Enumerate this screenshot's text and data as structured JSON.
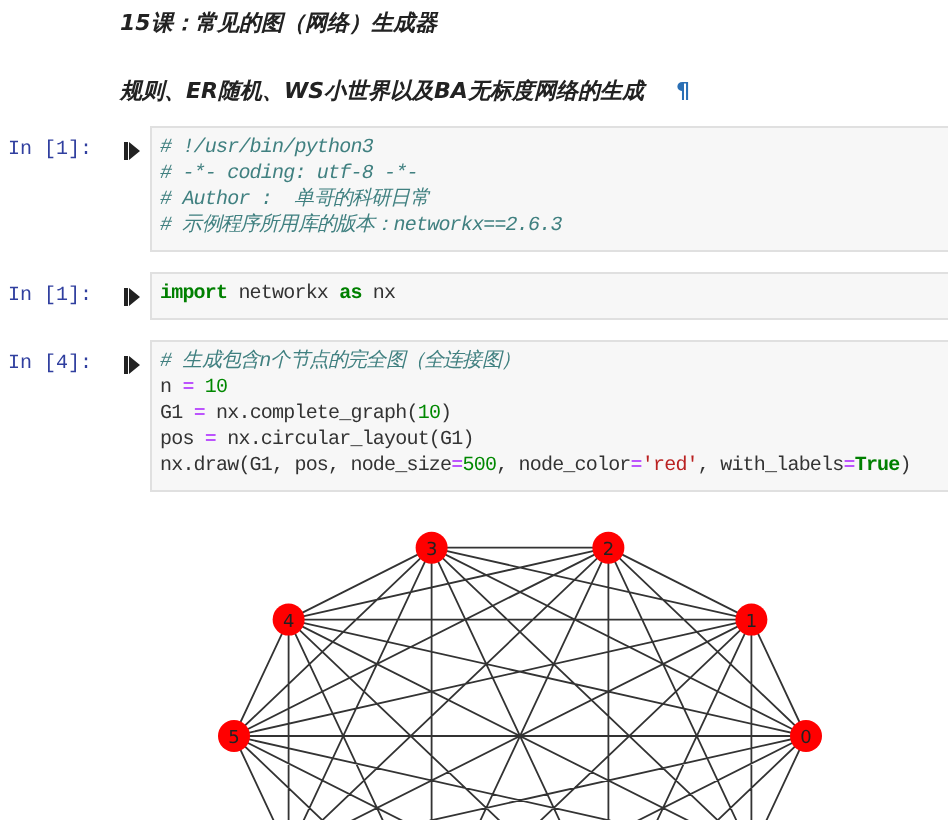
{
  "title": "15课：常见的图（网络）生成器",
  "subtitle": "规则、ER随机、WS小世界以及BA无标度网络的生成",
  "anchor": "¶",
  "cells": [
    {
      "prompt": "In [1]:",
      "lines": [
        [
          {
            "kind": "comment",
            "text": "# !/usr/bin/python3"
          }
        ],
        [
          {
            "kind": "comment",
            "text": "# -*- coding: utf-8 -*-"
          }
        ],
        [
          {
            "kind": "comment",
            "text": "# Author :  单哥的科研日常"
          }
        ],
        [
          {
            "kind": "comment",
            "text": "# 示例程序所用库的版本：networkx==2.6.3"
          }
        ]
      ]
    },
    {
      "prompt": "In [1]:",
      "lines": [
        [
          {
            "kind": "keyword",
            "text": "import"
          },
          {
            "kind": "plain",
            "text": " networkx "
          },
          {
            "kind": "keyword",
            "text": "as"
          },
          {
            "kind": "plain",
            "text": " nx"
          }
        ]
      ]
    },
    {
      "prompt": "In [4]:",
      "lines": [
        [
          {
            "kind": "comment",
            "text": "# 生成包含n个节点的完全图（全连接图）"
          }
        ],
        [
          {
            "kind": "plain",
            "text": "n "
          },
          {
            "kind": "operator",
            "text": "="
          },
          {
            "kind": "number",
            "text": " 10"
          }
        ],
        [
          {
            "kind": "plain",
            "text": "G1 "
          },
          {
            "kind": "operator",
            "text": "="
          },
          {
            "kind": "plain",
            "text": " nx.complete_graph("
          },
          {
            "kind": "number",
            "text": "10"
          },
          {
            "kind": "plain",
            "text": ")"
          }
        ],
        [
          {
            "kind": "plain",
            "text": "pos "
          },
          {
            "kind": "operator",
            "text": "="
          },
          {
            "kind": "plain",
            "text": " nx.circular_layout(G1)"
          }
        ],
        [
          {
            "kind": "plain",
            "text": "nx.draw(G1, pos, node_size"
          },
          {
            "kind": "operator",
            "text": "="
          },
          {
            "kind": "number",
            "text": "500"
          },
          {
            "kind": "plain",
            "text": ", node_color"
          },
          {
            "kind": "operator",
            "text": "="
          },
          {
            "kind": "string",
            "text": "'red'"
          },
          {
            "kind": "plain",
            "text": ", with_labels"
          },
          {
            "kind": "operator",
            "text": "="
          },
          {
            "kind": "keyword",
            "text": "True"
          },
          {
            "kind": "plain",
            "text": ")"
          }
        ]
      ]
    }
  ],
  "graph": {
    "node_labels": [
      "0",
      "1",
      "2",
      "3",
      "4",
      "5"
    ]
  }
}
